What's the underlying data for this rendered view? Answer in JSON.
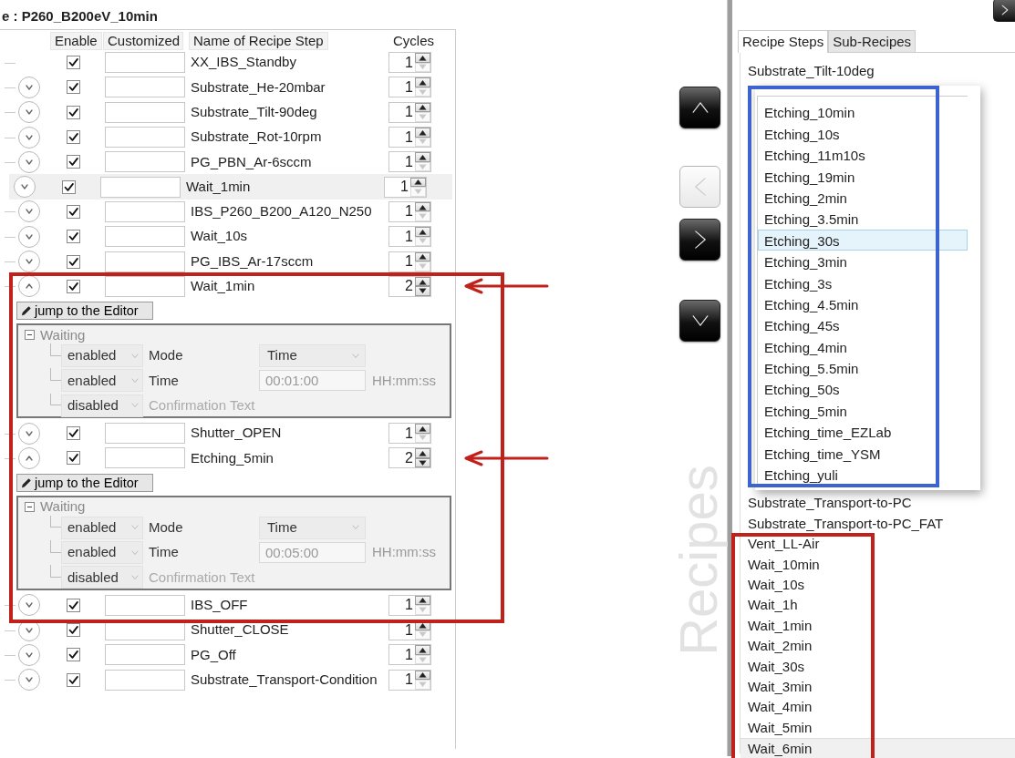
{
  "title": "e : P260_B200eV_10min",
  "columns": [
    "Enable",
    "Customized",
    "Name of Recipe Step",
    "Cycles"
  ],
  "steps": [
    {
      "enabled": true,
      "name": "XX_IBS_Standby",
      "cycles": "1",
      "down_enabled": false,
      "selected": false
    },
    {
      "expanded": false,
      "enabled": true,
      "name": "Substrate_He-20mbar",
      "cycles": "1",
      "down_enabled": false,
      "selected": false
    },
    {
      "expanded": false,
      "enabled": true,
      "name": "Substrate_Tilt-90deg",
      "cycles": "1",
      "down_enabled": false,
      "selected": false
    },
    {
      "expanded": false,
      "enabled": true,
      "name": "Substrate_Rot-10rpm",
      "cycles": "1",
      "down_enabled": false,
      "selected": false
    },
    {
      "expanded": false,
      "enabled": true,
      "name": "PG_PBN_Ar-6sccm",
      "cycles": "1",
      "down_enabled": false,
      "selected": false
    },
    {
      "expanded": false,
      "enabled": true,
      "name": "Wait_1min",
      "cycles": "1",
      "down_enabled": false,
      "selected": true
    },
    {
      "expanded": false,
      "enabled": true,
      "name": "IBS_P260_B200_A120_N250",
      "cycles": "1",
      "down_enabled": false,
      "selected": false
    },
    {
      "expanded": false,
      "enabled": true,
      "name": "Wait_10s",
      "cycles": "1",
      "down_enabled": false,
      "selected": false
    },
    {
      "expanded": false,
      "enabled": true,
      "name": "PG_IBS_Ar-17sccm",
      "cycles": "1",
      "down_enabled": false,
      "selected": false
    },
    {
      "expanded": true,
      "enabled": true,
      "name": "Wait_1min",
      "cycles": "2",
      "down_enabled": true,
      "selected": false,
      "detail": {
        "button": "jump to the Editor",
        "group": "Waiting",
        "expanded": true,
        "params": [
          {
            "kind": "select",
            "state": "enabled",
            "active": true,
            "label": "Mode",
            "value": "Time"
          },
          {
            "kind": "time",
            "state": "enabled",
            "active": true,
            "label": "Time",
            "value": "00:01:00",
            "unit": "HH:mm:ss"
          },
          {
            "kind": "text",
            "state": "disabled",
            "active": false,
            "label": "Confirmation Text"
          }
        ]
      }
    },
    {
      "expanded": false,
      "enabled": true,
      "name": "Shutter_OPEN",
      "cycles": "1",
      "down_enabled": false,
      "selected": false
    },
    {
      "expanded": true,
      "enabled": true,
      "name": "Etching_5min",
      "cycles": "2",
      "down_enabled": true,
      "selected": false,
      "detail": {
        "button": "jump to the Editor",
        "group": "Waiting",
        "expanded": true,
        "params": [
          {
            "kind": "select",
            "state": "enabled",
            "active": true,
            "label": "Mode",
            "value": "Time"
          },
          {
            "kind": "time",
            "state": "enabled",
            "active": true,
            "label": "Time",
            "value": "00:05:00",
            "unit": "HH:mm:ss"
          },
          {
            "kind": "text",
            "state": "disabled",
            "active": false,
            "label": "Confirmation Text"
          }
        ]
      }
    },
    {
      "expanded": false,
      "enabled": true,
      "name": "IBS_OFF",
      "cycles": "1",
      "down_enabled": false,
      "selected": false
    },
    {
      "expanded": false,
      "enabled": true,
      "name": "Shutter_CLOSE",
      "cycles": "1",
      "down_enabled": false,
      "selected": false
    },
    {
      "expanded": false,
      "enabled": true,
      "name": "PG_Off",
      "cycles": "1",
      "down_enabled": false,
      "selected": false
    },
    {
      "expanded": false,
      "enabled": true,
      "name": "Substrate_Transport-Condition",
      "cycles": "1",
      "down_enabled": false,
      "selected": false
    }
  ],
  "nav_buttons": [
    {
      "kind": "up",
      "disabled": false
    },
    {
      "kind": "left",
      "disabled": true
    },
    {
      "kind": "right",
      "disabled": false
    },
    {
      "kind": "down",
      "disabled": false
    }
  ],
  "side_label": "Recipes",
  "annotations": [
    {
      "kind": "frame",
      "color": "#c0211b"
    },
    {
      "kind": "arrow",
      "color": "#c0211b"
    },
    {
      "kind": "arrow",
      "color": "#c0211b"
    },
    {
      "kind": "frame",
      "color": "#3d63cf"
    },
    {
      "kind": "frame",
      "color": "#c0211b"
    }
  ],
  "tabs": [
    {
      "label": "Recipe Steps",
      "selected": true
    },
    {
      "label": "Sub-Recipes",
      "selected": false
    }
  ],
  "recipe_list": [
    {
      "kind": "item",
      "label": "Substrate_Tilt-10deg",
      "selected": false
    },
    {
      "kind": "dropdown",
      "items": [
        {
          "label": "Etching_10min",
          "selected": false
        },
        {
          "label": "Etching_10s",
          "selected": false
        },
        {
          "label": "Etching_11m10s",
          "selected": false
        },
        {
          "label": "Etching_19min",
          "selected": false
        },
        {
          "label": "Etching_2min",
          "selected": false
        },
        {
          "label": "Etching_3.5min",
          "selected": false
        },
        {
          "label": "Etching_30s",
          "selected": true
        },
        {
          "label": "Etching_3min",
          "selected": false
        },
        {
          "label": "Etching_3s",
          "selected": false
        },
        {
          "label": "Etching_4.5min",
          "selected": false
        },
        {
          "label": "Etching_45s",
          "selected": false
        },
        {
          "label": "Etching_4min",
          "selected": false
        },
        {
          "label": "Etching_5.5min",
          "selected": false
        },
        {
          "label": "Etching_50s",
          "selected": false
        },
        {
          "label": "Etching_5min",
          "selected": false
        },
        {
          "label": "Etching_time_EZLab",
          "selected": false
        },
        {
          "label": "Etching_time_YSM",
          "selected": false
        },
        {
          "label": "Etching_yuli",
          "selected": false
        }
      ]
    },
    {
      "kind": "item",
      "label": "Substrate_Transport-to-PC",
      "selected": false
    },
    {
      "kind": "item",
      "label": "Substrate_Transport-to-PC_FAT",
      "selected": false
    },
    {
      "kind": "item",
      "label": "Vent_LL-Air",
      "selected": false
    },
    {
      "kind": "item",
      "label": "Wait_10min",
      "selected": false
    },
    {
      "kind": "item",
      "label": "Wait_10s",
      "selected": false
    },
    {
      "kind": "item",
      "label": "Wait_1h",
      "selected": false
    },
    {
      "kind": "item",
      "label": "Wait_1min",
      "selected": false
    },
    {
      "kind": "item",
      "label": "Wait_2min",
      "selected": false
    },
    {
      "kind": "item",
      "label": "Wait_30s",
      "selected": false
    },
    {
      "kind": "item",
      "label": "Wait_3min",
      "selected": false
    },
    {
      "kind": "item",
      "label": "Wait_4min",
      "selected": false
    },
    {
      "kind": "item",
      "label": "Wait_5min",
      "selected": false
    },
    {
      "kind": "item",
      "label": "Wait_6min",
      "selected": true
    }
  ]
}
